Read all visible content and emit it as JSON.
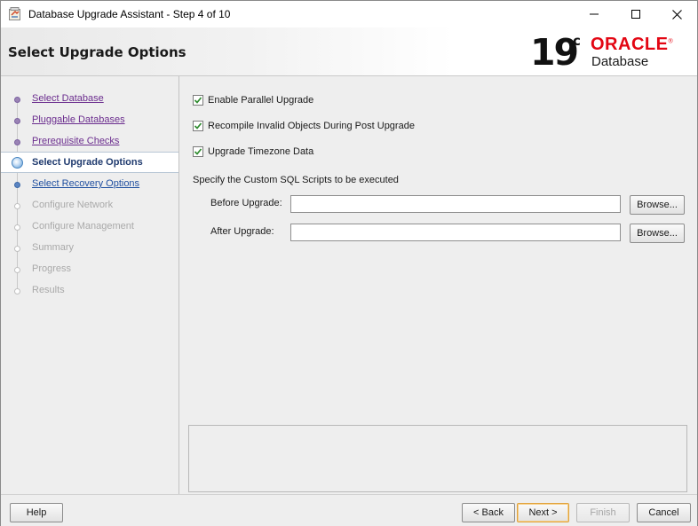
{
  "window": {
    "title": "Database Upgrade Assistant - Step 4 of 10",
    "controls": {
      "minimize": "minimize-icon",
      "maximize": "maximize-icon",
      "close": "close-icon"
    }
  },
  "header": {
    "page_title": "Select Upgrade Options",
    "logo": {
      "version": "19",
      "superscript": "c",
      "brand": "ORACLE",
      "registered": "®",
      "product": "Database"
    }
  },
  "sidebar": {
    "steps": [
      {
        "label": "Select Database",
        "state": "done"
      },
      {
        "label": "Pluggable Databases",
        "state": "done"
      },
      {
        "label": "Prerequisite Checks",
        "state": "done"
      },
      {
        "label": "Select Upgrade Options",
        "state": "current"
      },
      {
        "label": "Select Recovery Options",
        "state": "next"
      },
      {
        "label": "Configure Network",
        "state": "pending"
      },
      {
        "label": "Configure Management",
        "state": "pending"
      },
      {
        "label": "Summary",
        "state": "pending"
      },
      {
        "label": "Progress",
        "state": "pending"
      },
      {
        "label": "Results",
        "state": "pending"
      }
    ]
  },
  "options": {
    "parallel_upgrade": {
      "label": "Enable Parallel Upgrade",
      "checked": true
    },
    "recompile_invalid": {
      "label": "Recompile Invalid Objects During Post Upgrade",
      "checked": true
    },
    "upgrade_timezone": {
      "label": "Upgrade Timezone Data",
      "checked": true
    }
  },
  "scripts": {
    "section_label": "Specify the Custom SQL Scripts to be executed",
    "before_label": "Before Upgrade:",
    "before_value": "",
    "after_label": "After Upgrade:",
    "after_value": "",
    "browse_label": "Browse..."
  },
  "footer": {
    "help": "Help",
    "back": "< Back",
    "next": "Next >",
    "finish": "Finish",
    "cancel": "Cancel"
  },
  "colors": {
    "oracle_red": "#e30613",
    "visited_link": "#6b2d8e",
    "next_link": "#1f4fa0",
    "current_step": "#1f3a6e",
    "disabled_text": "#a9a9a9",
    "default_button_border": "#e0a23c"
  }
}
